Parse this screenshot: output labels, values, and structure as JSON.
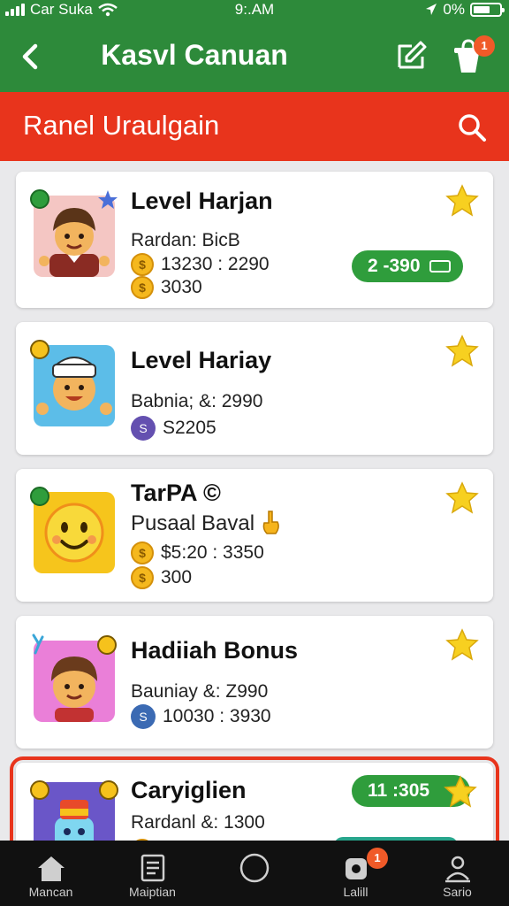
{
  "status_bar": {
    "carrier": "Car Suka",
    "time": "9:.AM",
    "battery_text": "0%",
    "wifi_icon": "wifi-icon",
    "location_icon": "location-arrow-icon"
  },
  "header": {
    "title": "Kasvl Canuan",
    "back_icon": "back-chevron-icon",
    "edit_icon": "edit-icon",
    "cart_icon": "shopping-bag-icon",
    "cart_badge": "1",
    "color": "#2d8a3a"
  },
  "subheader": {
    "title": "Ranel Uraulgain",
    "search_icon": "search-icon",
    "color": "#e8341c"
  },
  "cards": [
    {
      "title": "Level Harjan",
      "subtitle": "Rardan: BicB",
      "stats": [
        "13230 : 2290",
        "3030"
      ],
      "price": "2 -390",
      "starred": true
    },
    {
      "title": "Level Hariay",
      "subtitle": "Babnia; &: 2990",
      "stats": [
        "S2205"
      ],
      "starred": true
    },
    {
      "title": "TarPA ©",
      "subtitle": "Pusaal Baval",
      "stats": [
        "$5:20 : 3350",
        "300"
      ],
      "starred": true
    },
    {
      "title": "Hadiiah Bonus",
      "subtitle": "Bauniay &: Z990",
      "stats": [
        "10030 : 3930"
      ],
      "starred": true
    },
    {
      "title": "Caryiglien",
      "subtitle": "Rardanl &: 1300",
      "price": "11 :305",
      "starred": true,
      "highlighted": true
    }
  ],
  "bottom_nav": [
    {
      "label": "Mancan",
      "icon": "home-icon"
    },
    {
      "label": "Maiptian",
      "icon": "document-icon"
    },
    {
      "label": "",
      "icon": "circle-home-button-icon"
    },
    {
      "label": "Lalill",
      "icon": "notification-icon",
      "badge": "1"
    },
    {
      "label": "Sario",
      "icon": "profile-icon"
    }
  ]
}
